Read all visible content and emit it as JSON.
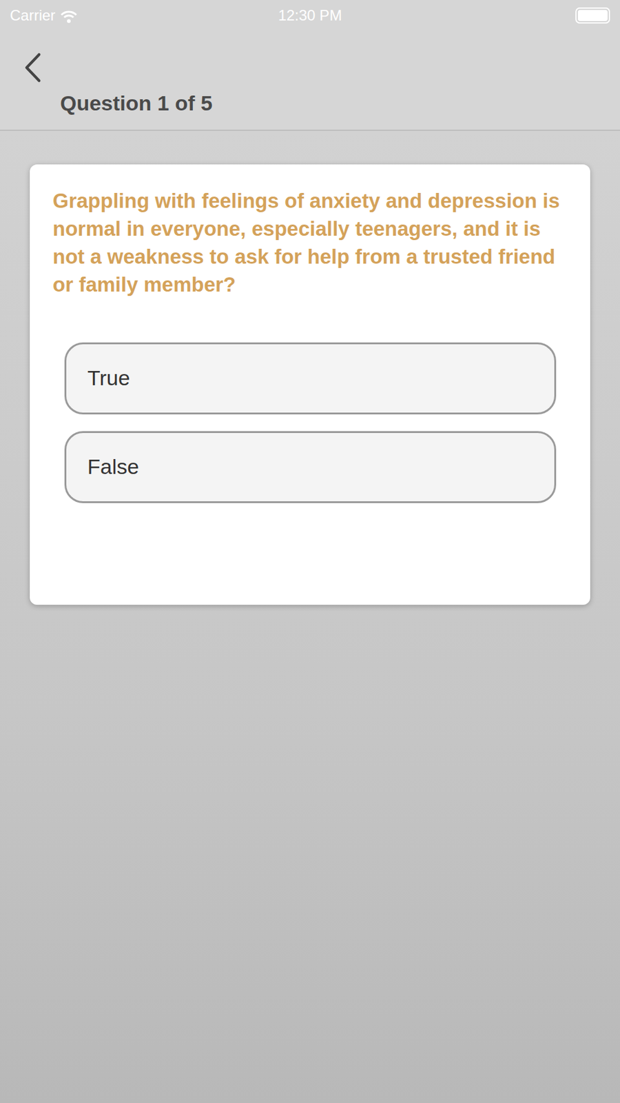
{
  "status_bar": {
    "carrier": "Carrier",
    "time": "12:30 PM"
  },
  "header": {
    "title": "Question 1 of 5"
  },
  "question": {
    "text": "Grappling with feelings of anxiety and depression is normal in everyone, especially teenagers, and it is not a weakness to ask for help from a trusted friend or family member?"
  },
  "options": [
    {
      "label": "True",
      "selected": false
    },
    {
      "label": "False",
      "selected": false
    }
  ]
}
